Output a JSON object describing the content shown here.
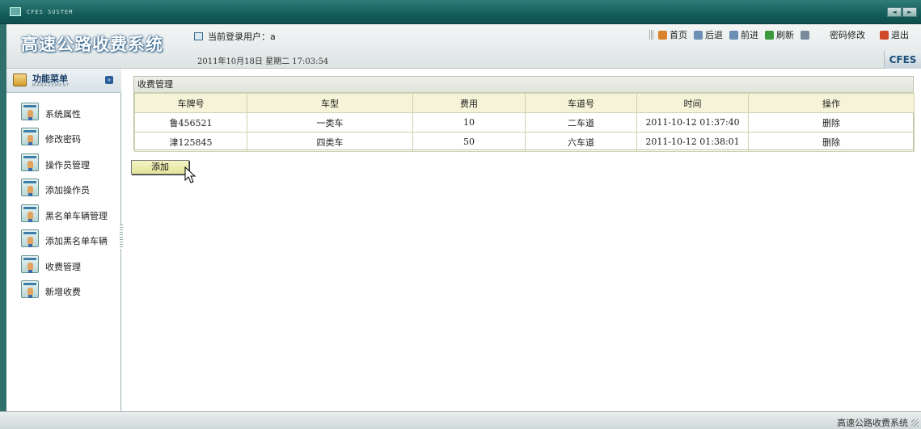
{
  "system_bar": {
    "name": "CFES SUSTEM",
    "nav_prev": "◄",
    "nav_next": "►"
  },
  "header": {
    "app_title": "高速公路收费系统",
    "current_user_label": "当前登录用户：",
    "current_user": "a",
    "datetime": "2011年10月18日  星期二  17:03:54",
    "brand": "CFES",
    "links": [
      {
        "label": "首页",
        "icon": "home-icon",
        "color": "#d9822b"
      },
      {
        "label": "后退",
        "icon": "back-icon",
        "color": "#6b8fb5"
      },
      {
        "label": "前进",
        "icon": "forward-icon",
        "color": "#6b8fb5"
      },
      {
        "label": "刷新",
        "icon": "refresh-icon",
        "color": "#3c9a3c"
      },
      {
        "label": "密码修改",
        "icon": "edit-icon",
        "color": "#7b8b9b"
      },
      {
        "label": "退出",
        "icon": "exit-icon",
        "color": "#d04a2a"
      }
    ]
  },
  "sidebar": {
    "title": "功能菜单",
    "subtitle": "MANAGEMENT",
    "items": [
      {
        "label": "系统属性"
      },
      {
        "label": "修改密码"
      },
      {
        "label": "操作员管理"
      },
      {
        "label": "添加操作员"
      },
      {
        "label": "黑名单车辆管理"
      },
      {
        "label": "添加黑名单车辆"
      },
      {
        "label": "收费管理"
      },
      {
        "label": "新增收费"
      }
    ]
  },
  "main": {
    "panel_title": "收费管理",
    "columns": [
      "车牌号",
      "车型",
      "费用",
      "车道号",
      "时间",
      "操作"
    ],
    "rows": [
      {
        "plate": "鲁456521",
        "type": "一类车",
        "fee": "10",
        "lane": "二车道",
        "time": "2011-10-12 01:37:40",
        "action": "删除"
      },
      {
        "plate": "津125845",
        "type": "四类车",
        "fee": "50",
        "lane": "六车道",
        "time": "2011-10-12 01:38:01",
        "action": "删除"
      }
    ],
    "add_button": "添加"
  },
  "status_bar": {
    "text": "高速公路收费系统"
  },
  "colors": {
    "frame_teal": "#155c59",
    "table_header_bg": "#f5f4d8",
    "add_button_bg": "#ecec b0"
  }
}
